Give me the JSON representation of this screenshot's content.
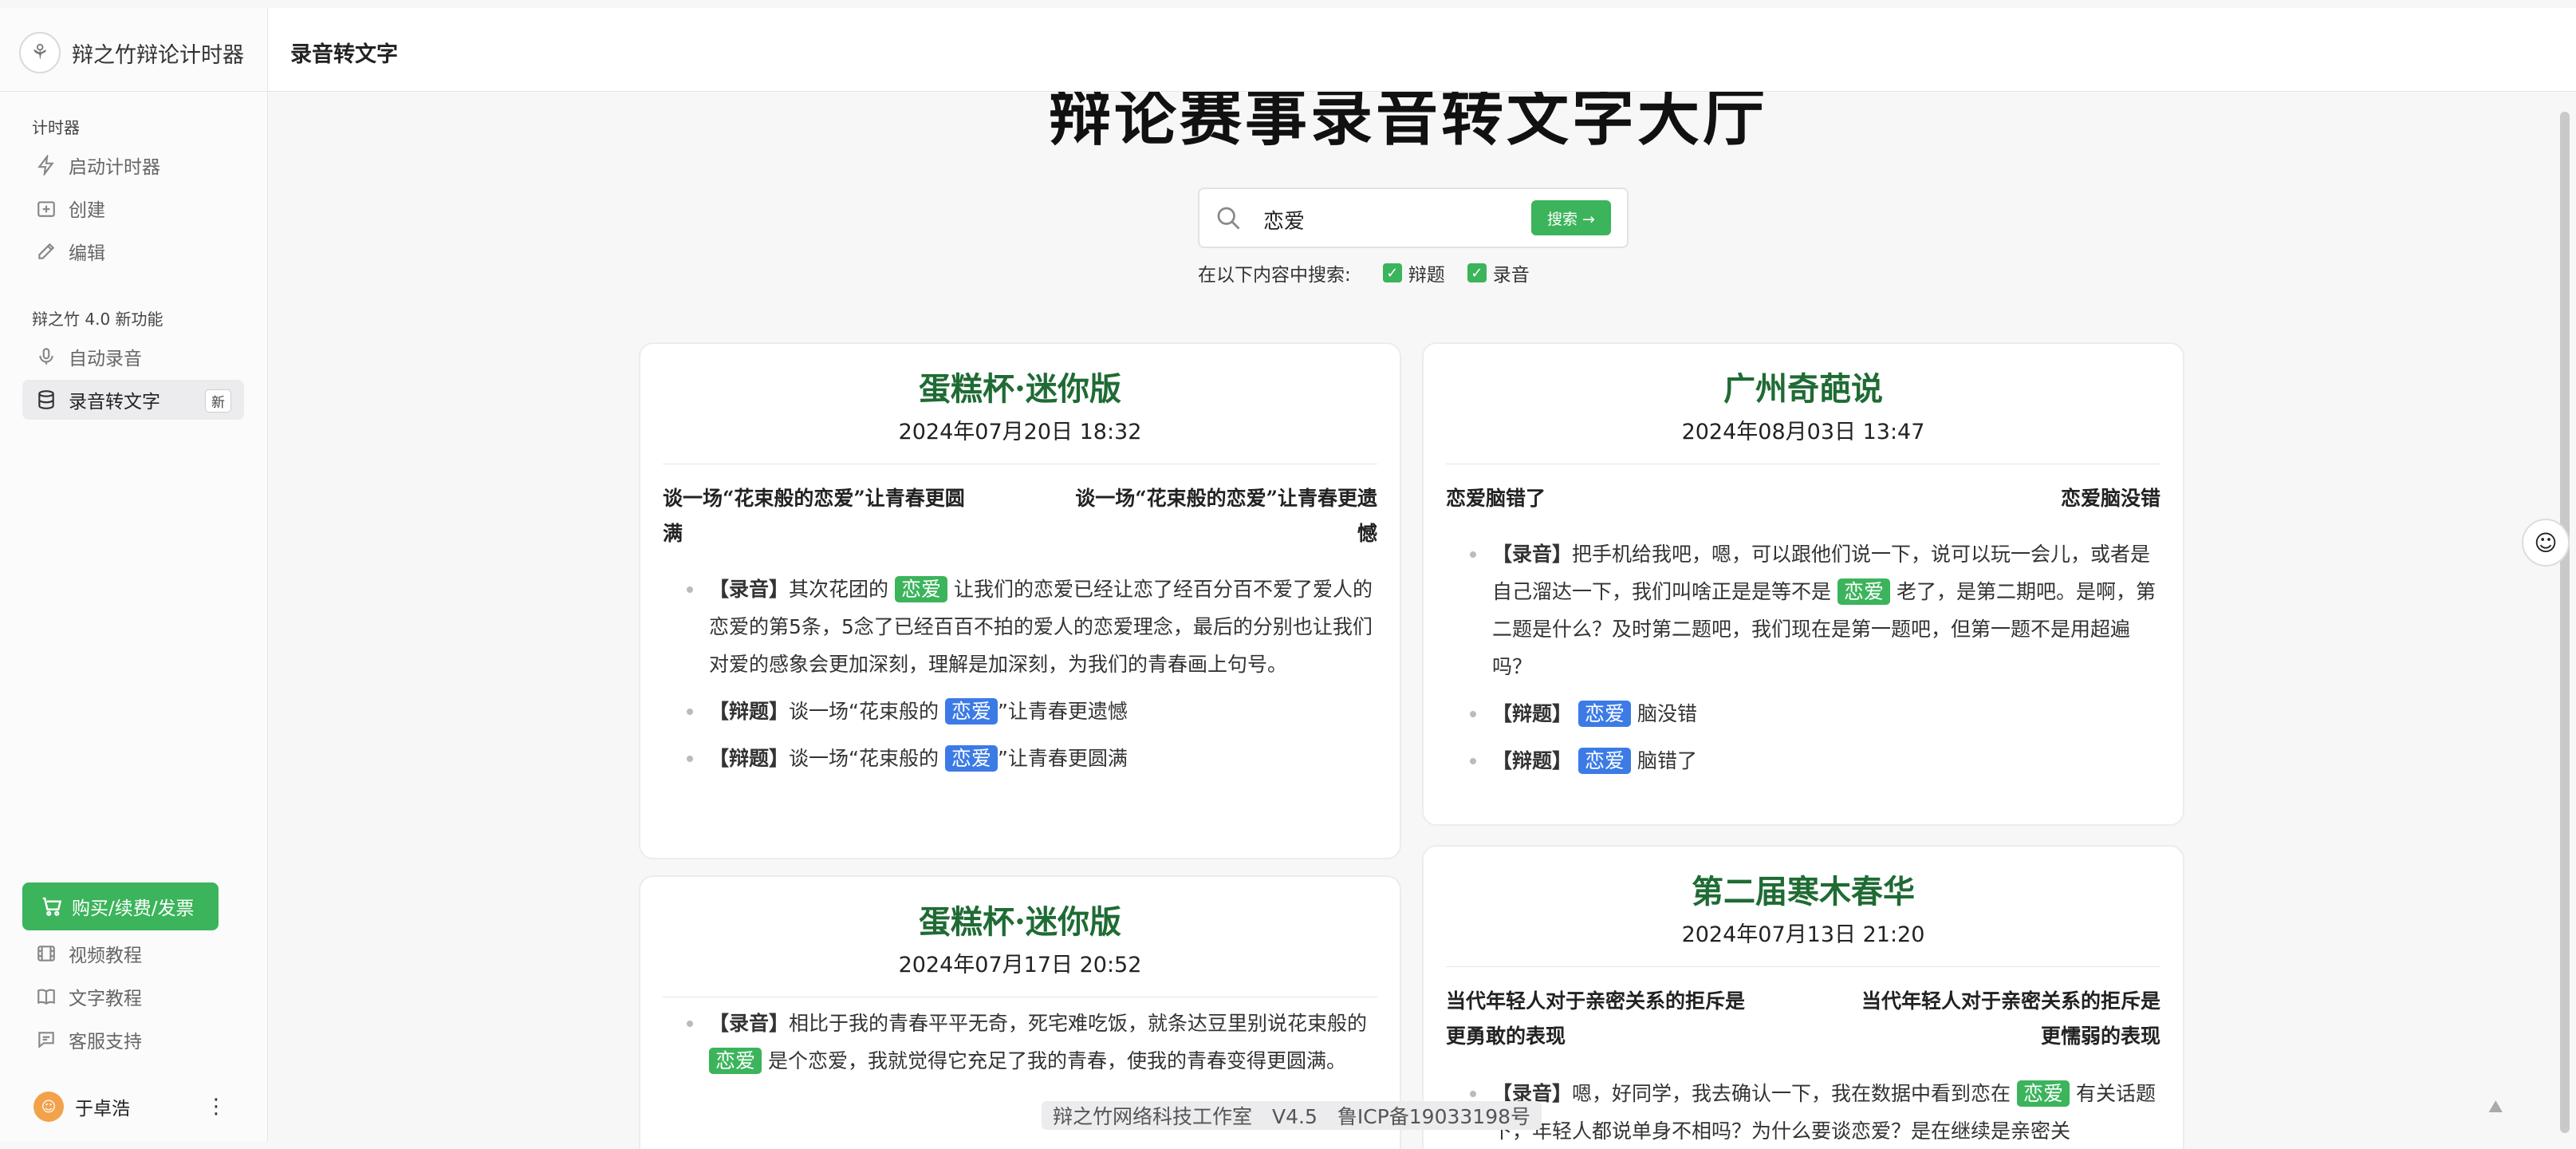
{
  "app": {
    "name": "辩之竹辩论计时器"
  },
  "header": {
    "title": "录音转文字"
  },
  "sidebar": {
    "section1": "计时器",
    "items1": [
      {
        "label": "启动计时器",
        "icon": "bolt-icon"
      },
      {
        "label": "创建",
        "icon": "add-square-icon"
      },
      {
        "label": "编辑",
        "icon": "edit-icon"
      }
    ],
    "section2": "辩之竹 4.0 新功能",
    "items2": [
      {
        "label": "自动录音",
        "icon": "microphone-icon"
      },
      {
        "label": "录音转文字",
        "icon": "database-icon",
        "badge": "新",
        "active": true
      }
    ],
    "buy_label": "购买/续费/发票",
    "bottom_items": [
      {
        "label": "视频教程",
        "icon": "film-icon"
      },
      {
        "label": "文字教程",
        "icon": "book-icon"
      },
      {
        "label": "客服支持",
        "icon": "chat-icon"
      }
    ],
    "user_name": "于卓浩"
  },
  "main": {
    "page_title": "辩论赛事录音转文字大厅",
    "search": {
      "value": "恋爱",
      "button": "搜索 →"
    },
    "filter": {
      "label": "在以下内容中搜索:",
      "options": [
        {
          "label": "辩题",
          "checked": true
        },
        {
          "label": "录音",
          "checked": true
        }
      ]
    },
    "cards": [
      {
        "title": "蛋糕杯·迷你版",
        "date": "2024年07月20日 18:32",
        "side_left": "谈一场“花束般的恋爱”让青春更圆满",
        "side_right": "谈一场“花束般的恋爱”让青春更遗憾",
        "e1_tag": "【录音】",
        "e1_a": "其次花团的",
        "e1_hl": "恋爱",
        "e1_b": "让我们的恋爱已经让恋了经百分百不爱了爱人的恋爱的第5条，5念了已经百百不拍的爱人的恋爱理念，最后的分别也让我们对爱的感象会更加深刻，理解是加深刻，为我们的青春画上句号。",
        "e2_tag": "【辩题】",
        "e2_a": "谈一场“花束般的",
        "e2_hl": "恋爱",
        "e2_b": "”让青春更遗憾",
        "e3_tag": "【辩题】",
        "e3_a": "谈一场“花束般的",
        "e3_hl": "恋爱",
        "e3_b": "”让青春更圆满"
      },
      {
        "title": "广州奇葩说",
        "date": "2024年08月03日 13:47",
        "side_left": "恋爱脑错了",
        "side_right": "恋爱脑没错",
        "e1_tag": "【录音】",
        "e1_a": "把手机给我吧，嗯，可以跟他们说一下，说可以玩一会儿，或者是自己溜达一下，我们叫啥正是是等不是",
        "e1_hl": "恋爱",
        "e1_b": "老了，是第二期吧。是啊，第二题是什么？及时第二题吧，我们现在是第一题吧，但第一题不是用超遍吗？",
        "e2_tag": "【辩题】",
        "e2_hl": "恋爱",
        "e2_b": "脑没错",
        "e3_tag": "【辩题】",
        "e3_hl": "恋爱",
        "e3_b": "脑错了"
      },
      {
        "title": "蛋糕杯·迷你版",
        "date": "2024年07月17日 20:52",
        "e1_tag": "【录音】",
        "e1_a": "相比于我的青春平平无奇，死宅难吃饭，就条达豆里别说花束般的",
        "e1_hl": "恋爱",
        "e1_b": "是个恋爱，我就觉得它充足了我的青春，使我的青春变得更圆满。"
      },
      {
        "title": "第二届寒木春华",
        "date": "2024年07月13日 21:20",
        "side_left": "当代年轻人对于亲密关系的拒斥是更勇敢的表现",
        "side_right": "当代年轻人对于亲密关系的拒斥是更懦弱的表现",
        "e1_tag": "【录音】",
        "e1_a": "嗯，好同学，我去确认一下，我在数据中看到恋在",
        "e1_hl": "恋爱",
        "e1_b": "有关话题下，年轻人都说单身不相吗？为什么要谈恋爱？是在继续是亲密关"
      }
    ]
  },
  "footer": {
    "text": "辩之竹网络科技工作室　V4.5　鲁ICP备19033198号"
  }
}
